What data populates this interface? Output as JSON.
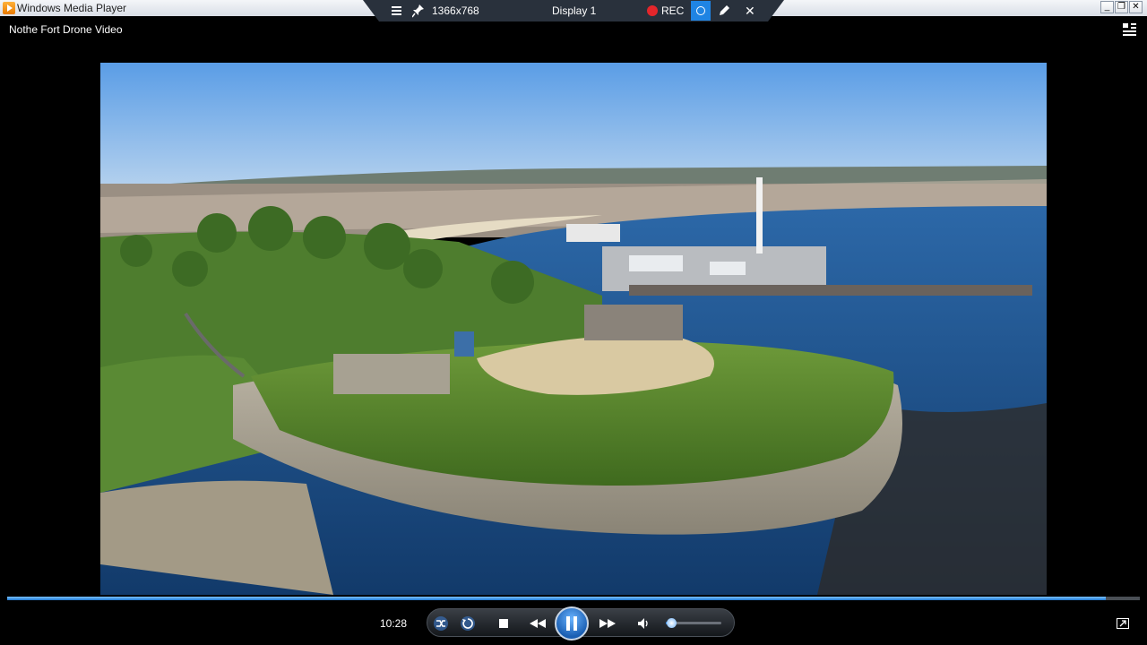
{
  "window": {
    "title": "Windows Media Player",
    "min_label": "_",
    "max_label": "❐",
    "close_label": "✕"
  },
  "remote_bar": {
    "resolution": "1366x768",
    "display": "Display 1",
    "rec_label": "REC",
    "close_label": "✕"
  },
  "video": {
    "title": "Nothe Fort Drone Video"
  },
  "playback": {
    "time": "10:28",
    "progress": 0.97,
    "volume": 0.1
  },
  "colors": {
    "accent": "#1f84e3",
    "rec": "#e4262b"
  },
  "icons": [
    "app-icon",
    "menu-icon",
    "pin-icon",
    "record-dot-icon",
    "pen-icon",
    "close-icon",
    "collapse-icon",
    "shuffle-icon",
    "repeat-icon",
    "stop-icon",
    "previous-icon",
    "pause-icon",
    "next-icon",
    "volume-icon",
    "switch-to-library-icon"
  ]
}
